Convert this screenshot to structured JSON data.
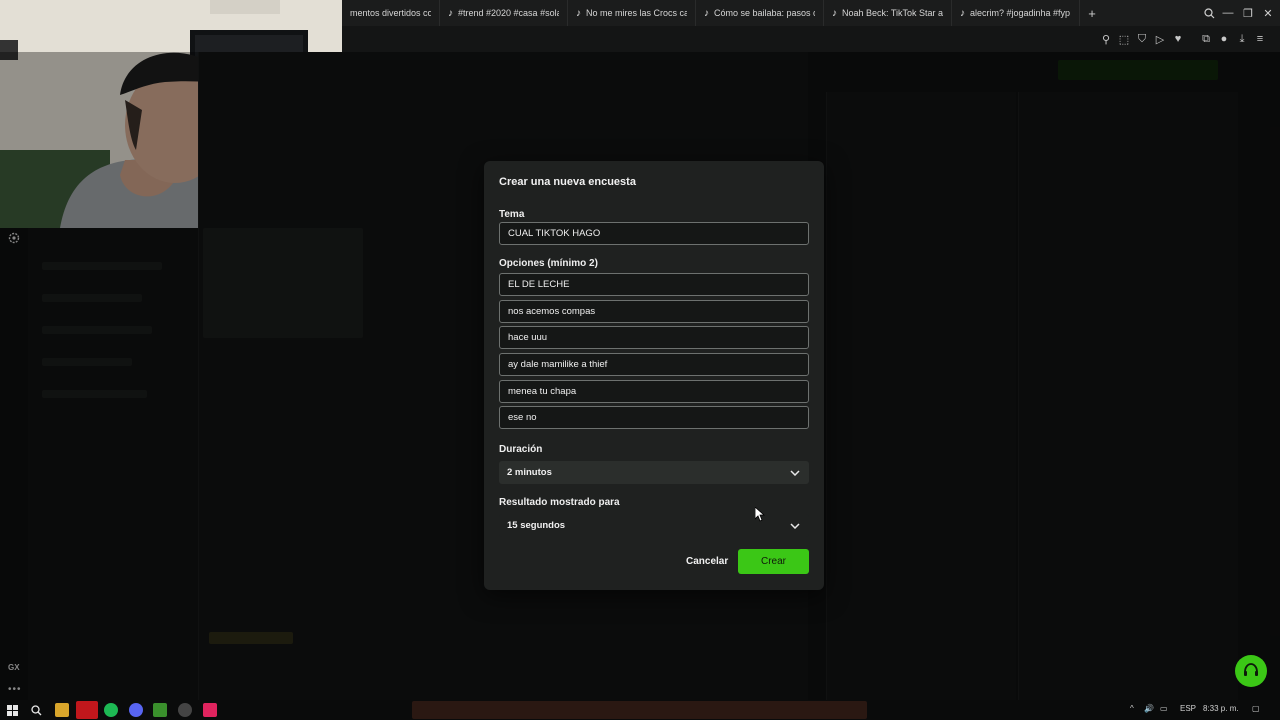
{
  "browser": {
    "tabs": [
      {
        "label": "mentos divertidos con",
        "icon": "tiktok-icon"
      },
      {
        "label": "#trend #2020 #casa #sola",
        "icon": "tiktok-icon"
      },
      {
        "label": "No me mires las Crocs can",
        "icon": "tiktok-icon"
      },
      {
        "label": "Cómo se bailaba: pasos c",
        "icon": "tiktok-icon"
      },
      {
        "label": "Noah Beck: TikTok Star an",
        "icon": "tiktok-icon"
      },
      {
        "label": "alecrim? #jogadinha #fyp",
        "icon": "tiktok-icon"
      }
    ],
    "new_tab": "+"
  },
  "modal": {
    "title": "Crear una nueva encuesta",
    "topic_label": "Tema",
    "topic_value": "CUAL TIKTOK HAGO",
    "options_label": "Opciones (mínimo 2)",
    "options": [
      "EL DE LECHE",
      "nos acemos compas",
      "hace uuu",
      "ay dale mamilike a thief",
      "menea tu chapa",
      "ese no"
    ],
    "duration_label": "Duración",
    "duration_value": "2 minutos",
    "result_label": "Resultado mostrado para",
    "result_value": "15 segundos",
    "cancel_label": "Cancelar",
    "create_label": "Crear"
  },
  "sidebar": {
    "gx_label": "GX"
  },
  "taskbar": {
    "language": "ESP",
    "time": "8:33 p. m."
  },
  "colors": {
    "accent": "#3bc716",
    "modal_bg": "#1f2120"
  }
}
